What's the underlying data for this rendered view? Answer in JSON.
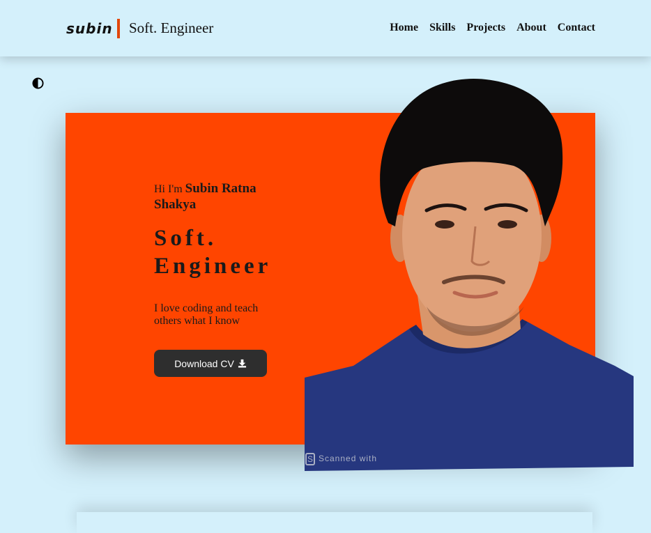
{
  "header": {
    "logo_text": "subin",
    "role_text": "Soft. Engineer",
    "nav": [
      {
        "label": "Home"
      },
      {
        "label": "Skills"
      },
      {
        "label": "Projects"
      },
      {
        "label": "About"
      },
      {
        "label": "Contact"
      }
    ]
  },
  "theme_toggle": {
    "icon": "contrast-icon"
  },
  "hero": {
    "greeting_prefix": "Hi I'm",
    "name": "Subin Ratna Shakya",
    "title": "Soft. Engineer",
    "tagline": "I love coding and teach others what I know",
    "cv_button_label": "Download CV",
    "cv_button_icon": "download-icon",
    "watermark_text": "Scanned with"
  },
  "colors": {
    "background": "#d4f0fb",
    "accent": "#ff4500",
    "logo_bar": "#e2470b",
    "button": "#2e2e2e"
  }
}
